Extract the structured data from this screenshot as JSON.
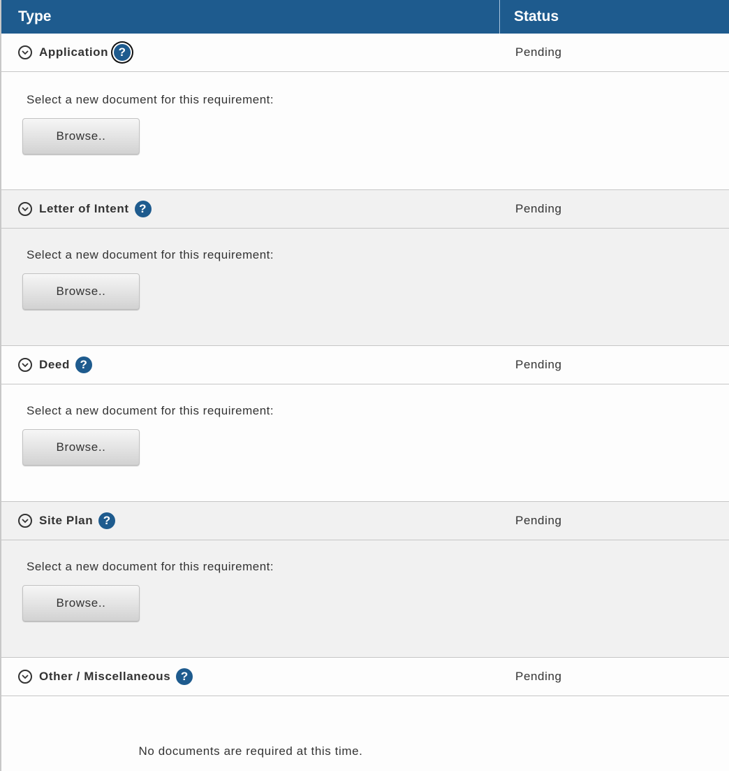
{
  "header": {
    "type_label": "Type",
    "status_label": "Status"
  },
  "requirements": [
    {
      "title": "Application",
      "status": "Pending",
      "prompt": "Select a new document for this requirement:",
      "button_label": "Browse.."
    },
    {
      "title": "Letter of Intent",
      "status": "Pending",
      "prompt": "Select a new document for this requirement:",
      "button_label": "Browse.."
    },
    {
      "title": "Deed",
      "status": "Pending",
      "prompt": "Select a new document for this requirement:",
      "button_label": "Browse.."
    },
    {
      "title": "Site Plan",
      "status": "Pending",
      "prompt": "Select a new document for this requirement:",
      "button_label": "Browse.."
    },
    {
      "title": "Other / Miscellaneous",
      "status": "Pending",
      "message": "No documents are required at this time."
    }
  ],
  "icons": {
    "toggle": "chevron-circle-down-icon",
    "help": "question-circle-icon",
    "help_glyph": "?"
  },
  "colors": {
    "header_bg": "#1e5b8e",
    "help_bg": "#1e5b8e",
    "row_alt_bg": "#f1f1f1"
  }
}
